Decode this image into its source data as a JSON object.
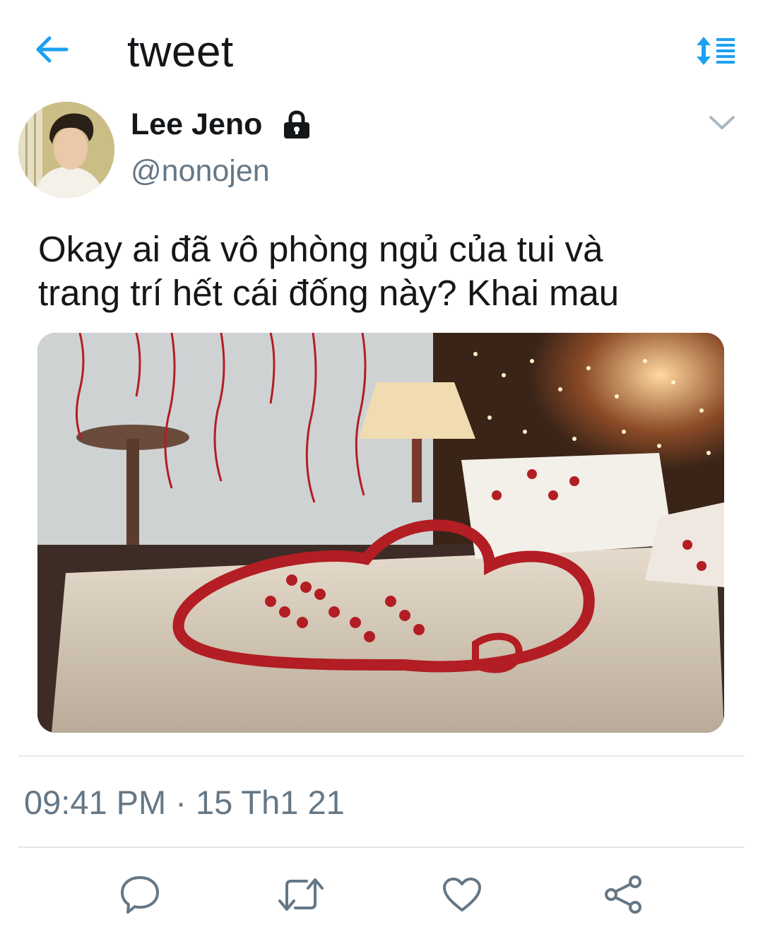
{
  "header": {
    "title": "tweet",
    "back_icon": "arrow-left-icon",
    "sort_icon": "sort-list-icon",
    "accent_color": "#1da1f2"
  },
  "tweet": {
    "display_name": "Lee Jeno",
    "handle": "@nonojen",
    "protected_icon": "lock-icon",
    "text_lines": [
      "Okay ai đã vô phòng ngủ của tui và",
      "trang trí hết cái đống này? Khai mau"
    ],
    "timestamp": "09:41 PM · 15 Th1 21"
  },
  "actions": [
    {
      "icon": "reply-icon"
    },
    {
      "icon": "retweet-icon"
    },
    {
      "icon": "like-icon"
    },
    {
      "icon": "share-icon"
    }
  ],
  "colors": {
    "text_primary": "#14171a",
    "text_secondary": "#657786",
    "divider": "#e1e8ed",
    "action_icon": "#657786"
  }
}
